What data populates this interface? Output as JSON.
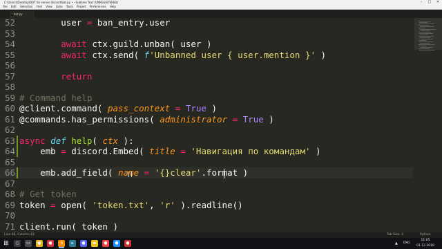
{
  "window": {
    "title": "C:\\Users\\\\Desktop\\BOT for server discord\\bot.py • - Sublime Text (UNREGISTERED)",
    "controls": [
      "–",
      "□",
      "✕"
    ]
  },
  "menu": [
    "File",
    "Edit",
    "Selection",
    "Find",
    "View",
    "Goto",
    "Tools",
    "Project",
    "Preferences",
    "Help"
  ],
  "tab": {
    "label": "bot.py"
  },
  "editor": {
    "lines": [
      {
        "num": "52",
        "code": "        user = ban_entry.user"
      },
      {
        "num": "53",
        "code": ""
      },
      {
        "num": "54",
        "code": "        await ctx.guild.unban( user )"
      },
      {
        "num": "55",
        "code": "        await ctx.send( f'Unbanned user { user.mention }' )"
      },
      {
        "num": "56",
        "code": ""
      },
      {
        "num": "57",
        "code": "        return"
      },
      {
        "num": "58",
        "code": ""
      },
      {
        "num": "59",
        "code": "# Command help"
      },
      {
        "num": "60",
        "code": "@client.command( pass_context = True )"
      },
      {
        "num": "61",
        "code": "@commands.has_permissions( administrator = True )"
      },
      {
        "num": "62",
        "code": ""
      },
      {
        "num": "63",
        "code": "async def help( ctx ):"
      },
      {
        "num": "64",
        "code": "    emb = discord.Embed( title = 'Навигация по командам' )"
      },
      {
        "num": "65",
        "code": ""
      },
      {
        "num": "66",
        "code": "    emb.add_field( name = '{}clear'.format )"
      },
      {
        "num": "67",
        "code": ""
      },
      {
        "num": "68",
        "code": "# Get token"
      },
      {
        "num": "69",
        "code": "token = open( 'token.txt', 'r' ).readline()"
      },
      {
        "num": "70",
        "code": ""
      },
      {
        "num": "71",
        "code": "client.run( token )"
      }
    ]
  },
  "status": {
    "position": "Line 66, Column 43",
    "tab_size": "Tab Size: 4",
    "syntax": "Python"
  },
  "taskbar": {
    "lang": "ENG",
    "time": "11:05",
    "date": "01.12.2019"
  },
  "colors": {
    "background": "#272822",
    "keyword": "#f92672",
    "function": "#a6e22e",
    "string": "#e6db74",
    "constant": "#ae81ff",
    "comment": "#75715e",
    "param": "#fd971f"
  }
}
